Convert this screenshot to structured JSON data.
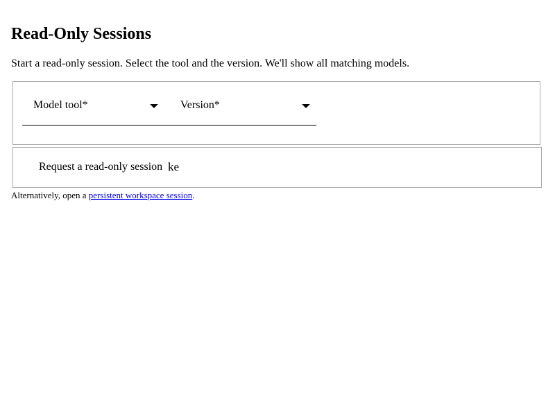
{
  "page": {
    "title": "Read-Only Sessions",
    "intro": "Start a read-only session. Select the tool and the version. We'll show all matching models."
  },
  "selectors": {
    "tool": {
      "label": "Model tool*",
      "icon": "caret-down-icon"
    },
    "version": {
      "label": "Version*",
      "icon": "caret-down-icon"
    }
  },
  "request": {
    "label": "Request a read-only session",
    "input_value": "ke"
  },
  "footer": {
    "prefix": "Alternatively, open a ",
    "link_text": "persistent workspace session",
    "suffix": "."
  },
  "colors": {
    "link": "#0000ee",
    "border": "#a9a9a9",
    "text": "#000000"
  }
}
